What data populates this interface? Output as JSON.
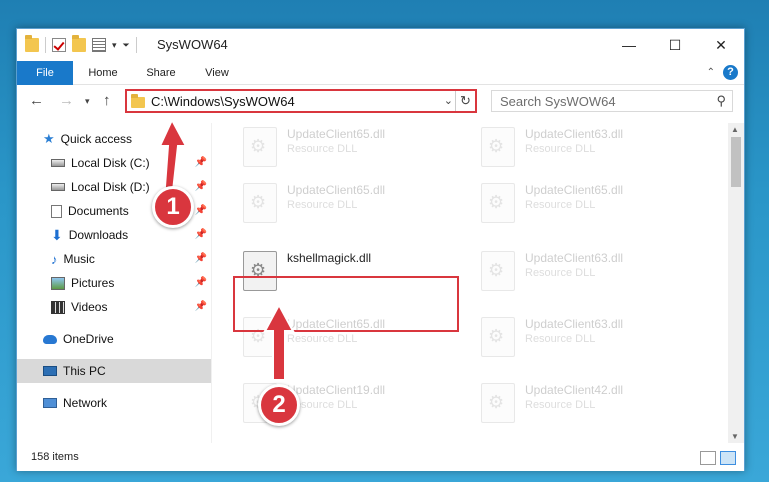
{
  "window": {
    "title": "SysWOW64",
    "controls": {
      "minimize": "—",
      "maximize": "☐",
      "close": "✕"
    }
  },
  "ribbon": {
    "tabs": [
      "File",
      "Home",
      "Share",
      "View"
    ],
    "help": "?"
  },
  "nav": {
    "address": "C:\\Windows\\SysWOW64",
    "search_placeholder": "Search SysWOW64"
  },
  "sidebar": {
    "items": [
      {
        "label": "Quick access",
        "icon": "star-icon"
      },
      {
        "label": "Local Disk (C:)",
        "icon": "drive-icon",
        "pinned": true
      },
      {
        "label": "Local Disk (D:)",
        "icon": "drive-icon",
        "pinned": true
      },
      {
        "label": "Documents",
        "icon": "document-icon",
        "pinned": true
      },
      {
        "label": "Downloads",
        "icon": "download-icon",
        "pinned": true
      },
      {
        "label": "Music",
        "icon": "music-icon",
        "pinned": true
      },
      {
        "label": "Pictures",
        "icon": "picture-icon",
        "pinned": true
      },
      {
        "label": "Videos",
        "icon": "video-icon",
        "pinned": true
      },
      {
        "label": "OneDrive",
        "icon": "cloud-icon"
      },
      {
        "label": "This PC",
        "icon": "computer-icon",
        "selected": true
      },
      {
        "label": "Network",
        "icon": "network-icon"
      }
    ]
  },
  "files": [
    {
      "name": "UpdateClient65.dll",
      "type": "Resource DLL"
    },
    {
      "name": "UpdateClient63.dll",
      "type": "Resource DLL"
    },
    {
      "name": "UpdateClient65.dll",
      "type": "Resource DLL"
    },
    {
      "name": "UpdateClient65.dll",
      "type": "Resource DLL"
    },
    {
      "name": "kshellmagick.dll",
      "type": "",
      "highlighted": true
    },
    {
      "name": "UpdateClient63.dll",
      "type": "Resource DLL"
    },
    {
      "name": "UpdateClient65.dll",
      "type": "Resource DLL"
    },
    {
      "name": "UpdateClient63.dll",
      "type": "Resource DLL"
    },
    {
      "name": "UpdateClient19.dll",
      "type": "Resource DLL"
    },
    {
      "name": "UpdateClient42.dll",
      "type": "Resource DLL"
    }
  ],
  "status": {
    "count": "158 items"
  },
  "annotations": {
    "step1": "1",
    "step2": "2",
    "color": "#d9363e"
  }
}
